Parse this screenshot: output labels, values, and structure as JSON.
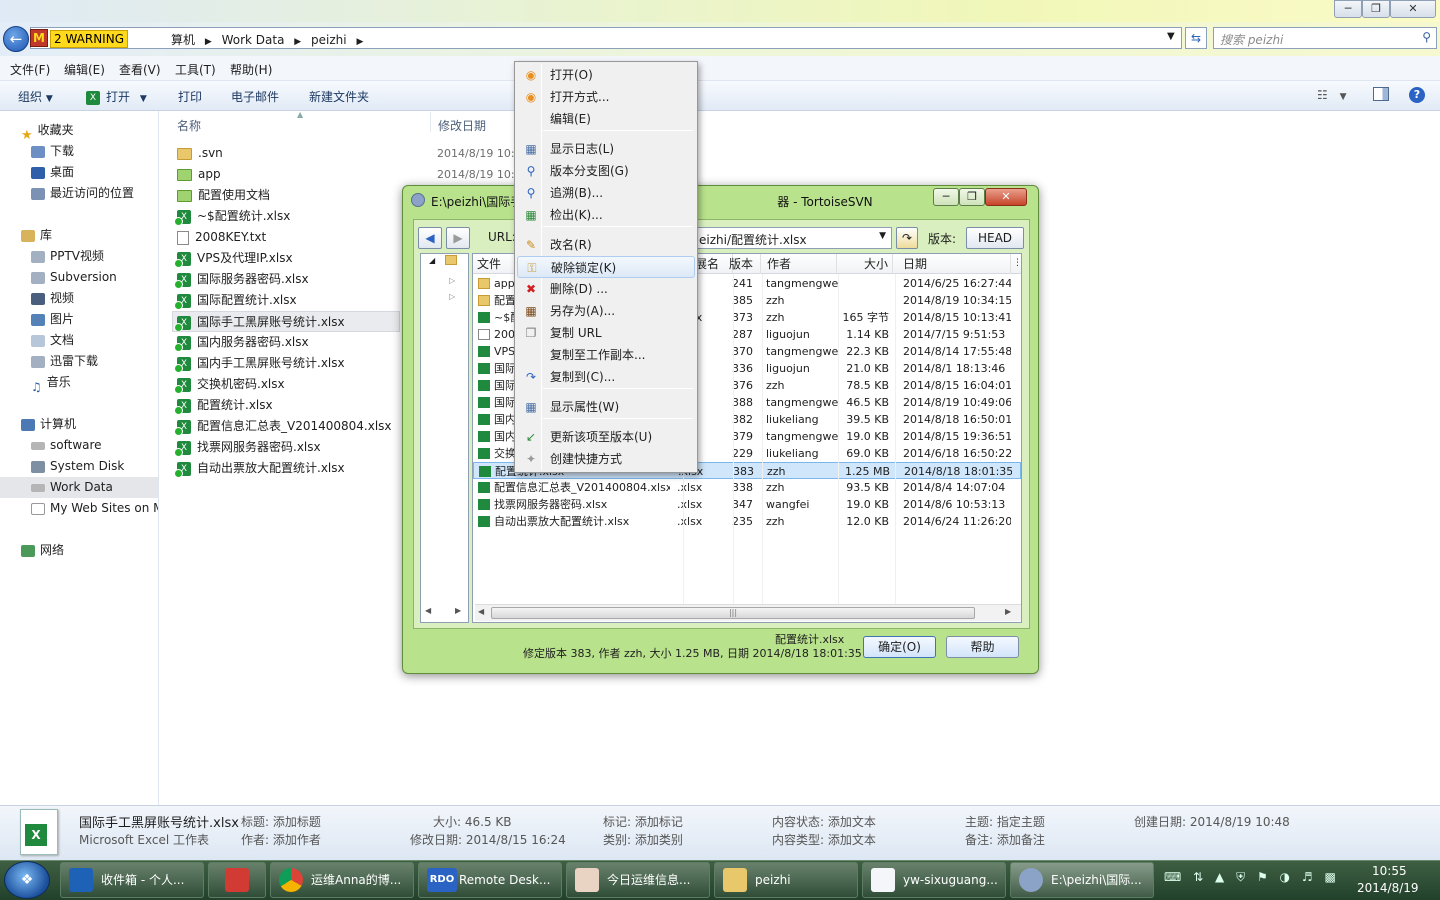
{
  "explorer": {
    "warning_label": "2 WARNING",
    "breadcrumb": [
      "算机",
      "Work Data",
      "peizhi"
    ],
    "search_placeholder": "搜索 peizhi",
    "menu": [
      "文件(F)",
      "编辑(E)",
      "查看(V)",
      "工具(T)",
      "帮助(H)"
    ],
    "toolbar": {
      "organize": "组织",
      "open": "打开",
      "print": "打印",
      "email": "电子邮件",
      "new_folder": "新建文件夹"
    },
    "nav": {
      "favorites": "收藏夹",
      "downloads": "下载",
      "desktop": "桌面",
      "recent": "最近访问的位置",
      "libraries": "库",
      "pptv": "PPTV视频",
      "subversion": "Subversion",
      "videos": "视频",
      "pictures": "图片",
      "documents": "文档",
      "xunlei": "迅雷下载",
      "music": "音乐",
      "computer": "计算机",
      "software": "software",
      "system_disk": "System Disk",
      "work_data": "Work Data",
      "my_web_sites": "My Web Sites on MS",
      "network": "网络"
    },
    "columns": {
      "name": "名称",
      "modified": "修改日期"
    },
    "files": [
      {
        "name": ".svn",
        "date": "2014/8/19 10:4"
      },
      {
        "name": "app",
        "date": "2014/8/19 10:4"
      },
      {
        "name": "配置使用文档",
        "date": ""
      },
      {
        "name": "~$配置统计.xlsx",
        "date": ""
      },
      {
        "name": "2008KEY.txt",
        "date": ""
      },
      {
        "name": "VPS及代理IP.xlsx",
        "date": ""
      },
      {
        "name": "国际服务器密码.xlsx",
        "date": ""
      },
      {
        "name": "国际配置统计.xlsx",
        "date": ""
      },
      {
        "name": "国际手工黑屏账号统计.xlsx",
        "date": ""
      },
      {
        "name": "国内服务器密码.xlsx",
        "date": ""
      },
      {
        "name": "国内手工黑屏账号统计.xlsx",
        "date": ""
      },
      {
        "name": "交换机密码.xlsx",
        "date": ""
      },
      {
        "name": "配置统计.xlsx",
        "date": ""
      },
      {
        "name": "配置信息汇总表_V201400804.xlsx",
        "date": ""
      },
      {
        "name": "找票网服务器密码.xlsx",
        "date": ""
      },
      {
        "name": "自动出票放大配置统计.xlsx",
        "date": ""
      }
    ],
    "details": {
      "filename": "国际手工黑屏账号统计.xlsx",
      "filetype": "Microsoft Excel 工作表",
      "title": "标题: 添加标题",
      "author": "作者: 添加作者",
      "size": "大小: 46.5 KB",
      "modified": "修改日期: 2014/8/15 16:24",
      "tags": "标记: 添加标记",
      "category": "类别: 添加类别",
      "content_status": "内容状态: 添加文本",
      "content_type": "内容类型: 添加文本",
      "subject": "主题: 指定主题",
      "comments": "备注: 添加备注",
      "created": "创建日期: 2014/8/19 10:48"
    }
  },
  "svn_dialog": {
    "title": "E:\\peizhi\\国际手...器 - TortoiseSVN",
    "title_left": "E:\\peizhi\\国际手",
    "title_right": "器 - TortoiseSVN",
    "url_label": "URL:",
    "url_value": "eizhi/配置统计.xlsx",
    "rev_label": "版本:",
    "rev_value": "HEAD",
    "columns": {
      "file": "文件",
      "ext": "展名",
      "rev": "版本",
      "author": "作者",
      "size": "大小",
      "date": "日期"
    },
    "rows": [
      {
        "name": "app",
        "ext": "",
        "rev": "241",
        "author": "tangmengwei",
        "size": "",
        "date": "2014/6/25 16:27:44"
      },
      {
        "name": "配置",
        "ext": "",
        "rev": "385",
        "author": "zzh",
        "size": "",
        "date": "2014/8/19 10:34:15"
      },
      {
        "name": "~$配",
        "ext": ".xlsx",
        "rev": "373",
        "author": "zzh",
        "size": "165 字节",
        "date": "2014/8/15 10:13:41"
      },
      {
        "name": "200",
        "ext": "",
        "rev": "287",
        "author": "liguojun",
        "size": "1.14 KB",
        "date": "2014/7/15 9:51:53"
      },
      {
        "name": "VPS",
        "ext": "",
        "rev": "370",
        "author": "tangmengwei",
        "size": "22.3 KB",
        "date": "2014/8/14 17:55:48"
      },
      {
        "name": "国际",
        "ext": "",
        "rev": "336",
        "author": "liguojun",
        "size": "21.0 KB",
        "date": "2014/8/1 18:13:46"
      },
      {
        "name": "国际",
        "ext": "",
        "rev": "376",
        "author": "zzh",
        "size": "78.5 KB",
        "date": "2014/8/15 16:04:01"
      },
      {
        "name": "国际",
        "ext": "",
        "rev": "388",
        "author": "tangmengwei",
        "size": "46.5 KB",
        "date": "2014/8/19 10:49:06"
      },
      {
        "name": "国内",
        "ext": "",
        "rev": "382",
        "author": "liukeliang",
        "size": "39.5 KB",
        "date": "2014/8/18 16:50:01"
      },
      {
        "name": "国内",
        "ext": "",
        "rev": "379",
        "author": "tangmengwei",
        "size": "19.0 KB",
        "date": "2014/8/15 19:36:51"
      },
      {
        "name": "交换",
        "ext": "",
        "rev": "229",
        "author": "liukeliang",
        "size": "69.0 KB",
        "date": "2014/6/18 16:50:22"
      },
      {
        "name": "配置统计.xlsx",
        "ext": ".xlsx",
        "rev": "383",
        "author": "zzh",
        "size": "1.25 MB",
        "date": "2014/8/18 18:01:35"
      },
      {
        "name": "配置信息汇总表_V201400804.xlsx",
        "ext": ".xlsx",
        "rev": "338",
        "author": "zzh",
        "size": "93.5 KB",
        "date": "2014/8/4 14:07:04"
      },
      {
        "name": "找票网服务器密码.xlsx",
        "ext": ".xlsx",
        "rev": "347",
        "author": "wangfei",
        "size": "19.0 KB",
        "date": "2014/8/6 10:53:13"
      },
      {
        "name": "自动出票放大配置统计.xlsx",
        "ext": ".xlsx",
        "rev": "235",
        "author": "zzh",
        "size": "12.0 KB",
        "date": "2014/6/24 11:26:20"
      }
    ],
    "status_file": "配置统计.xlsx",
    "status_detail": "修定版本 383, 作者 zzh, 大小 1.25 MB, 日期 2014/8/18 18:01:35",
    "ok_label": "确定(O)",
    "help_label": "帮助"
  },
  "context_menu": {
    "items": [
      "打开(O)",
      "打开方式...",
      "编辑(E)",
      "显示日志(L)",
      "版本分支图(G)",
      "追溯(B)...",
      "检出(K)...",
      "改名(R)",
      "破除锁定(K)",
      "删除(D) ...",
      "另存为(A)...",
      "复制 URL",
      "复制至工作副本...",
      "复制到(C)...",
      "显示属性(W)",
      "更新该项至版本(U)",
      "创建快捷方式"
    ],
    "highlighted_index": 8
  },
  "taskbar": {
    "items": [
      "收件箱 - 个人...",
      "",
      "运维Anna的博...",
      "Remote Desk...",
      "今日运维信息...",
      "peizhi",
      "yw-sixuguang...",
      "E:\\peizhi\\国际..."
    ],
    "rdo_label": "RDO",
    "clock_time": "10:55",
    "clock_date": "2014/8/19"
  },
  "colors": {
    "dialog_bg": "#b9e28c",
    "selection": "#cfe6fb",
    "taskbar": "#2e4e35",
    "warning": "#ffd91c"
  }
}
